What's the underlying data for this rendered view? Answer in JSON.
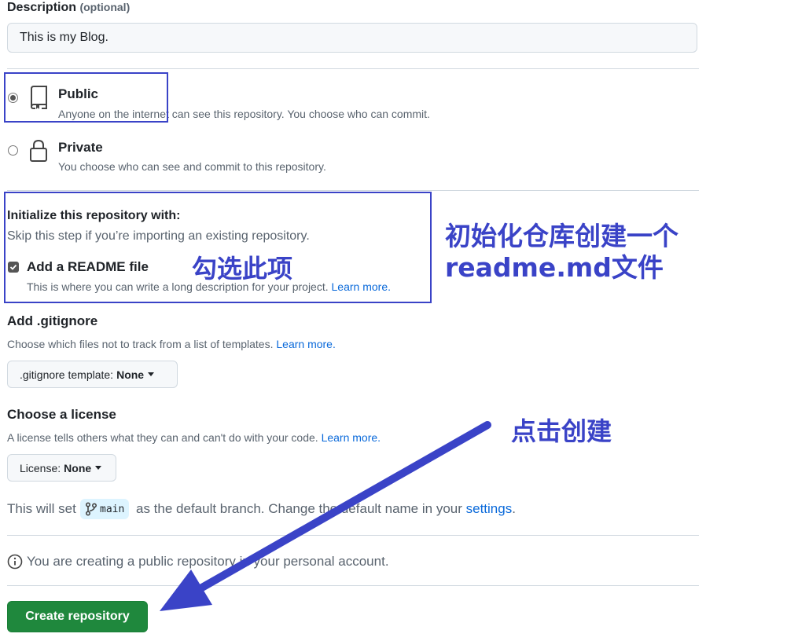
{
  "description": {
    "label": "Description",
    "optional": "(optional)",
    "value": "This is my Blog."
  },
  "visibility": {
    "public": {
      "title": "Public",
      "desc": "Anyone on the internet can see this repository. You choose who can commit.",
      "checked": true
    },
    "private": {
      "title": "Private",
      "desc": "You choose who can see and commit to this repository.",
      "checked": false
    }
  },
  "init": {
    "title": "Initialize this repository with:",
    "subtitle": "Skip this step if you’re importing an existing repository.",
    "readme_label": "Add a README file",
    "readme_checked": true,
    "readme_desc": "This is where you can write a long description for your project.",
    "readme_learn": "Learn more."
  },
  "gitignore": {
    "title": "Add .gitignore",
    "desc": "Choose which files not to track from a list of templates.",
    "learn": "Learn more.",
    "button_prefix": ".gitignore template:",
    "button_value": "None"
  },
  "license": {
    "title": "Choose a license",
    "desc": "A license tells others what they can and can't do with your code.",
    "learn": "Learn more.",
    "button_prefix": "License:",
    "button_value": "None"
  },
  "branch": {
    "before": "This will set",
    "name": "main",
    "after": "as the default branch. Change the default name in your",
    "settings": "settings",
    "period": "."
  },
  "info": "You are creating a public repository in your personal account.",
  "create_button": "Create repository",
  "annotations": {
    "init_note_line1": "初始化仓库创建一个",
    "init_note_line2": "readme.md文件",
    "check_note": "勾选此项",
    "click_note": "点击创建",
    "color": "#3a43c7"
  },
  "colors": {
    "link": "#0969da",
    "create_green": "#1f883d",
    "branch_bg": "#ddf4ff"
  }
}
